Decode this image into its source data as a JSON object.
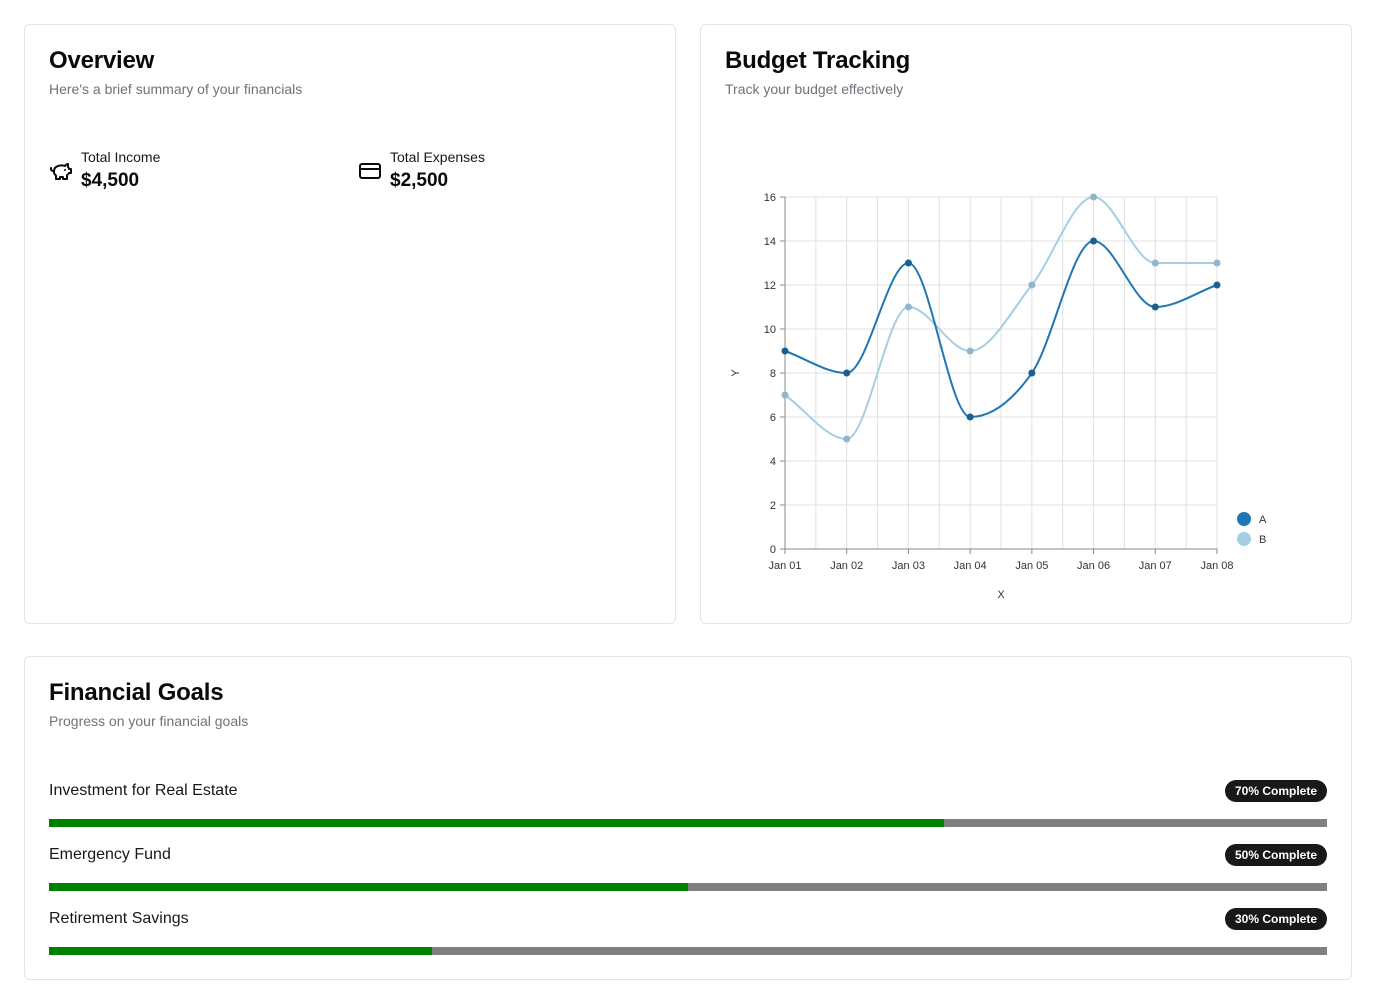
{
  "overview": {
    "title": "Overview",
    "subtitle": "Here's a brief summary of your financials",
    "stats": [
      {
        "label": "Total Income",
        "value": "$4,500",
        "icon": "piggy-bank-icon"
      },
      {
        "label": "Total Expenses",
        "value": "$2,500",
        "icon": "credit-card-icon"
      }
    ]
  },
  "budget": {
    "title": "Budget Tracking",
    "subtitle": "Track your budget effectively"
  },
  "chart_data": {
    "type": "line",
    "x": [
      "Jan 01",
      "Jan 02",
      "Jan 03",
      "Jan 04",
      "Jan 05",
      "Jan 06",
      "Jan 07",
      "Jan 08"
    ],
    "series": [
      {
        "name": "A",
        "values": [
          9,
          8,
          13,
          6,
          8,
          14,
          11,
          12
        ],
        "color": "#1f77b4"
      },
      {
        "name": "B",
        "values": [
          7,
          5,
          11,
          9,
          12,
          16,
          13,
          13
        ],
        "color": "#a6cee3"
      }
    ],
    "xlabel": "X",
    "ylabel": "Y",
    "ylim": [
      0,
      16
    ],
    "yticks": [
      0,
      2,
      4,
      6,
      8,
      10,
      12,
      14,
      16
    ],
    "grid": true,
    "legend": "bottom-right"
  },
  "goals": {
    "title": "Financial Goals",
    "subtitle": "Progress on your financial goals",
    "items": [
      {
        "label": "Investment for Real Estate",
        "badge": "70% Complete",
        "progress": 0.7
      },
      {
        "label": "Emergency Fund",
        "badge": "50% Complete",
        "progress": 0.5
      },
      {
        "label": "Retirement Savings",
        "badge": "30% Complete",
        "progress": 0.3
      }
    ],
    "fill_color": "#008000",
    "track_color": "#808080"
  }
}
